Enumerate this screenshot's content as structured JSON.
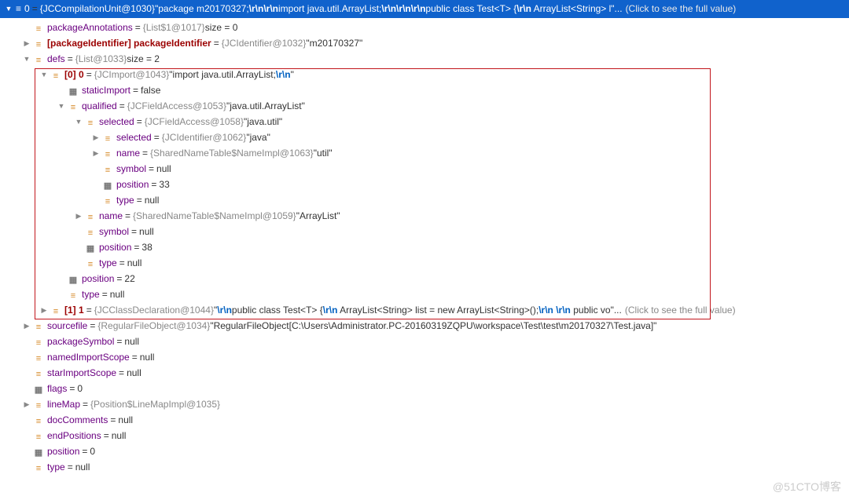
{
  "header": {
    "idx": "0",
    "ref": "{JCCompilationUnit@1030}",
    "str_pre": " \"package m20170327;",
    "str_mid": "import java.util.ArrayList;",
    "str_post": "public class Test<T> {",
    "str_tail": "    ArrayList<String> l\"...",
    "hint": "(Click to see the full value)"
  },
  "rows": [
    {
      "indent": 1,
      "tw": "",
      "icon": "field",
      "name": "packageAnnotations",
      "eq": "=",
      "gray": "{List$1@1017}",
      "tail": " size = 0"
    },
    {
      "indent": 1,
      "tw": "▶",
      "icon": "field",
      "nameBold": true,
      "name": "[packageIdentifier] packageIdentifier",
      "eq": "=",
      "gray": "{JCIdentifier@1032}",
      "tail": " \"m20170327\""
    },
    {
      "indent": 1,
      "tw": "▼",
      "icon": "field",
      "name": "defs",
      "eq": "=",
      "gray": "{List@1033}",
      "tail": " size = 2"
    }
  ],
  "box_rows": [
    {
      "indent": 2,
      "tw": "▼",
      "icon": "field",
      "nameBold": true,
      "name": "[0] 0",
      "eq": "=",
      "gray": "{JCImport@1043}",
      "tail_parts": [
        {
          "t": " \"import java.util.ArrayList;"
        },
        {
          "esc": "\\r\\n"
        },
        {
          "t": "\""
        }
      ]
    },
    {
      "indent": 3,
      "tw": "",
      "icon": "box",
      "name": "staticImport",
      "eq": "=",
      "tail": "false"
    },
    {
      "indent": 3,
      "tw": "▼",
      "icon": "field",
      "name": "qualified",
      "eq": "=",
      "gray": "{JCFieldAccess@1053}",
      "tail": " \"java.util.ArrayList\""
    },
    {
      "indent": 4,
      "tw": "▼",
      "icon": "field",
      "name": "selected",
      "eq": "=",
      "gray": "{JCFieldAccess@1058}",
      "tail": " \"java.util\""
    },
    {
      "indent": 5,
      "tw": "▶",
      "icon": "field",
      "name": "selected",
      "eq": "=",
      "gray": "{JCIdentifier@1062}",
      "tail": " \"java\""
    },
    {
      "indent": 5,
      "tw": "▶",
      "icon": "field",
      "name": "name",
      "eq": "=",
      "gray": "{SharedNameTable$NameImpl@1063}",
      "tail": " \"util\""
    },
    {
      "indent": 5,
      "tw": "",
      "icon": "field",
      "name": "symbol",
      "eq": "=",
      "tail": "null"
    },
    {
      "indent": 5,
      "tw": "",
      "icon": "box",
      "name": "position",
      "eq": "=",
      "tail": "33"
    },
    {
      "indent": 5,
      "tw": "",
      "icon": "field",
      "name": "type",
      "eq": "=",
      "tail": "null"
    },
    {
      "indent": 4,
      "tw": "▶",
      "icon": "field",
      "name": "name",
      "eq": "=",
      "gray": "{SharedNameTable$NameImpl@1059}",
      "tail": " \"ArrayList\""
    },
    {
      "indent": 4,
      "tw": "",
      "icon": "field",
      "name": "symbol",
      "eq": "=",
      "tail": "null"
    },
    {
      "indent": 4,
      "tw": "",
      "icon": "box",
      "name": "position",
      "eq": "=",
      "tail": "38"
    },
    {
      "indent": 4,
      "tw": "",
      "icon": "field",
      "name": "type",
      "eq": "=",
      "tail": "null"
    },
    {
      "indent": 3,
      "tw": "",
      "icon": "box",
      "name": "position",
      "eq": "=",
      "tail": "22"
    },
    {
      "indent": 3,
      "tw": "",
      "icon": "field",
      "name": "type",
      "eq": "=",
      "tail": "null"
    },
    {
      "indent": 2,
      "tw": "▶",
      "icon": "field",
      "nameBold": true,
      "name": "[1] 1",
      "eq": "=",
      "gray": "{JCClassDeclaration@1044}",
      "tail_parts": [
        {
          "t": " \""
        },
        {
          "esc": "\\r\\n"
        },
        {
          "t": "public class Test<T> {"
        },
        {
          "esc": "\\r\\n"
        },
        {
          "t": "    ArrayList<String> list = new ArrayList<String>();"
        },
        {
          "esc": "\\r\\n"
        },
        {
          "t": "    "
        },
        {
          "esc": "\\r\\n"
        },
        {
          "t": "    public vo\"..."
        }
      ],
      "hint": "(Click to see the full value)"
    }
  ],
  "after_rows": [
    {
      "indent": 1,
      "tw": "▶",
      "icon": "field",
      "name": "sourcefile",
      "eq": "=",
      "gray": "{RegularFileObject@1034}",
      "tail": " \"RegularFileObject[C:\\Users\\Administrator.PC-20160319ZQPU\\workspace\\Test\\test\\m20170327\\Test.java]\""
    },
    {
      "indent": 1,
      "tw": "",
      "icon": "field",
      "name": "packageSymbol",
      "eq": "=",
      "tail": "null"
    },
    {
      "indent": 1,
      "tw": "",
      "icon": "field",
      "name": "namedImportScope",
      "eq": "=",
      "tail": "null"
    },
    {
      "indent": 1,
      "tw": "",
      "icon": "field",
      "name": "starImportScope",
      "eq": "=",
      "tail": "null"
    },
    {
      "indent": 1,
      "tw": "",
      "icon": "box",
      "name": "flags",
      "eq": "=",
      "tail": "0"
    },
    {
      "indent": 1,
      "tw": "▶",
      "icon": "field",
      "name": "lineMap",
      "eq": "=",
      "gray": "{Position$LineMapImpl@1035}",
      "tail": ""
    },
    {
      "indent": 1,
      "tw": "",
      "icon": "field",
      "name": "docComments",
      "eq": "=",
      "tail": "null"
    },
    {
      "indent": 1,
      "tw": "",
      "icon": "field",
      "name": "endPositions",
      "eq": "=",
      "tail": "null"
    },
    {
      "indent": 1,
      "tw": "",
      "icon": "box",
      "name": "position",
      "eq": "=",
      "tail": "0"
    },
    {
      "indent": 1,
      "tw": "",
      "icon": "field",
      "name": "type",
      "eq": "=",
      "tail": "null"
    }
  ],
  "watermark": "@51CTO博客"
}
